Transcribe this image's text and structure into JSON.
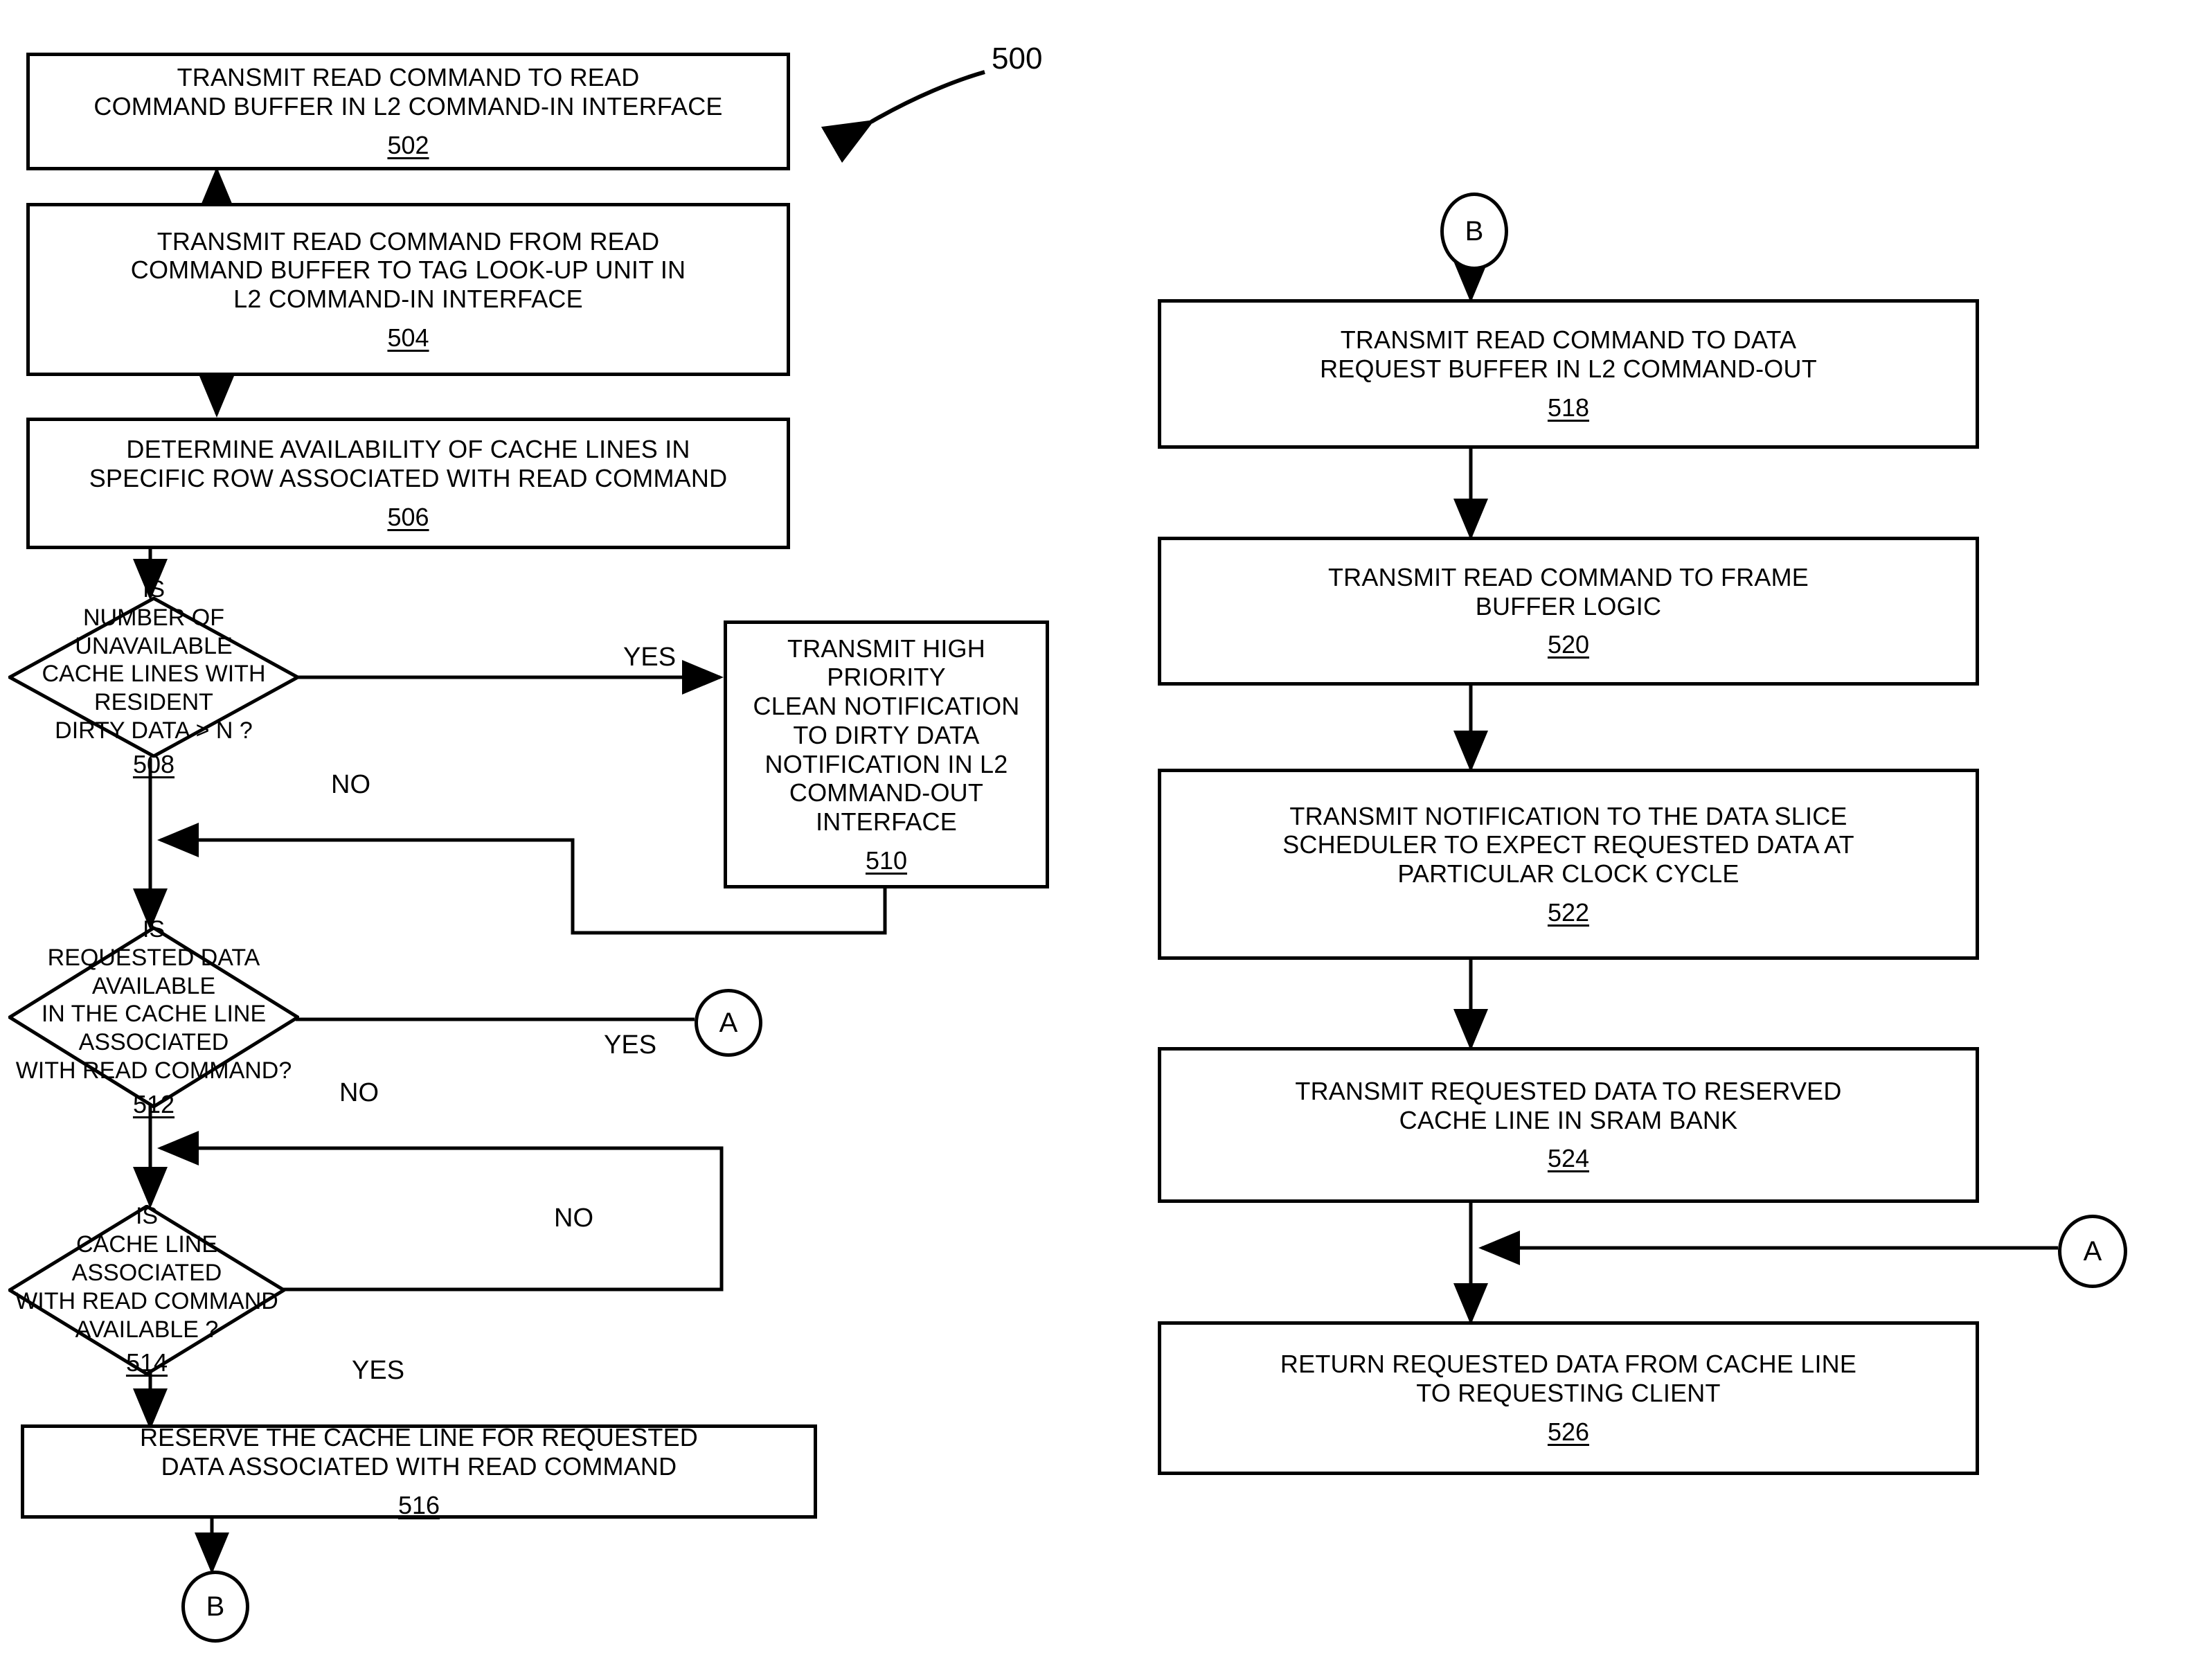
{
  "figure": {
    "number": "500",
    "leader_label": "500"
  },
  "colors": {
    "ink": "#000000",
    "paper": "#ffffff"
  },
  "nodes": {
    "n502": {
      "kind": "process",
      "text": "TRANSMIT READ COMMAND TO READ\nCOMMAND BUFFER IN  L2  COMMAND-IN INTERFACE",
      "ref": "502"
    },
    "n504": {
      "kind": "process",
      "text": "TRANSMIT READ COMMAND FROM READ\nCOMMAND BUFFER TO TAG LOOK-UP UNIT IN\nL2  COMMAND-IN INTERFACE",
      "ref": "504"
    },
    "n506": {
      "kind": "process",
      "text": "DETERMINE AVAILABILITY OF CACHE LINES IN\nSPECIFIC ROW ASSOCIATED WITH READ COMMAND",
      "ref": "506"
    },
    "n508": {
      "kind": "decision",
      "text": "IS\nNUMBER OF UNAVAILABLE\nCACHE LINES WITH RESIDENT\nDIRTY DATA > N ?",
      "ref": "508"
    },
    "n510": {
      "kind": "process",
      "text": "TRANSMIT HIGH PRIORITY\nCLEAN NOTIFICATION\nTO DIRTY DATA\nNOTIFICATION IN L2\nCOMMAND-OUT\nINTERFACE",
      "ref": "510"
    },
    "n512": {
      "kind": "decision",
      "text": "IS\nREQUESTED DATA AVAILABLE\nIN THE CACHE LINE ASSOCIATED\nWITH READ COMMAND?",
      "ref": "512"
    },
    "n514": {
      "kind": "decision",
      "text": "IS\nCACHE LINE ASSOCIATED\nWITH  READ  COMMAND\nAVAILABLE ?",
      "ref": "514"
    },
    "n516": {
      "kind": "process",
      "text": "RESERVE THE CACHE LINE FOR REQUESTED\nDATA ASSOCIATED WITH READ COMMAND",
      "ref": "516"
    },
    "n518": {
      "kind": "process",
      "text": "TRANSMIT READ COMMAND TO DATA\nREQUEST BUFFER IN  L2  COMMAND-OUT",
      "ref": "518"
    },
    "n520": {
      "kind": "process",
      "text": "TRANSMIT READ COMMAND TO FRAME\nBUFFER LOGIC",
      "ref": "520"
    },
    "n522": {
      "kind": "process",
      "text": "TRANSMIT NOTIFICATION TO THE DATA SLICE\nSCHEDULER TO EXPECT REQUESTED DATA AT\nPARTICULAR CLOCK CYCLE",
      "ref": "522"
    },
    "n524": {
      "kind": "process",
      "text": "TRANSMIT REQUESTED DATA TO RESERVED\nCACHE LINE IN SRAM BANK",
      "ref": "524"
    },
    "n526": {
      "kind": "process",
      "text": "RETURN REQUESTED DATA FROM CACHE LINE\nTO REQUESTING CLIENT",
      "ref": "526"
    }
  },
  "connectors": {
    "a_from_512": "A",
    "b_from_516": "B",
    "b_to_518": "B",
    "a_to_526": "A"
  },
  "edge_labels": {
    "yes_508": "YES",
    "no_508": "NO",
    "yes_512": "YES",
    "no_512": "NO",
    "no_514": "NO",
    "yes_514": "YES"
  }
}
